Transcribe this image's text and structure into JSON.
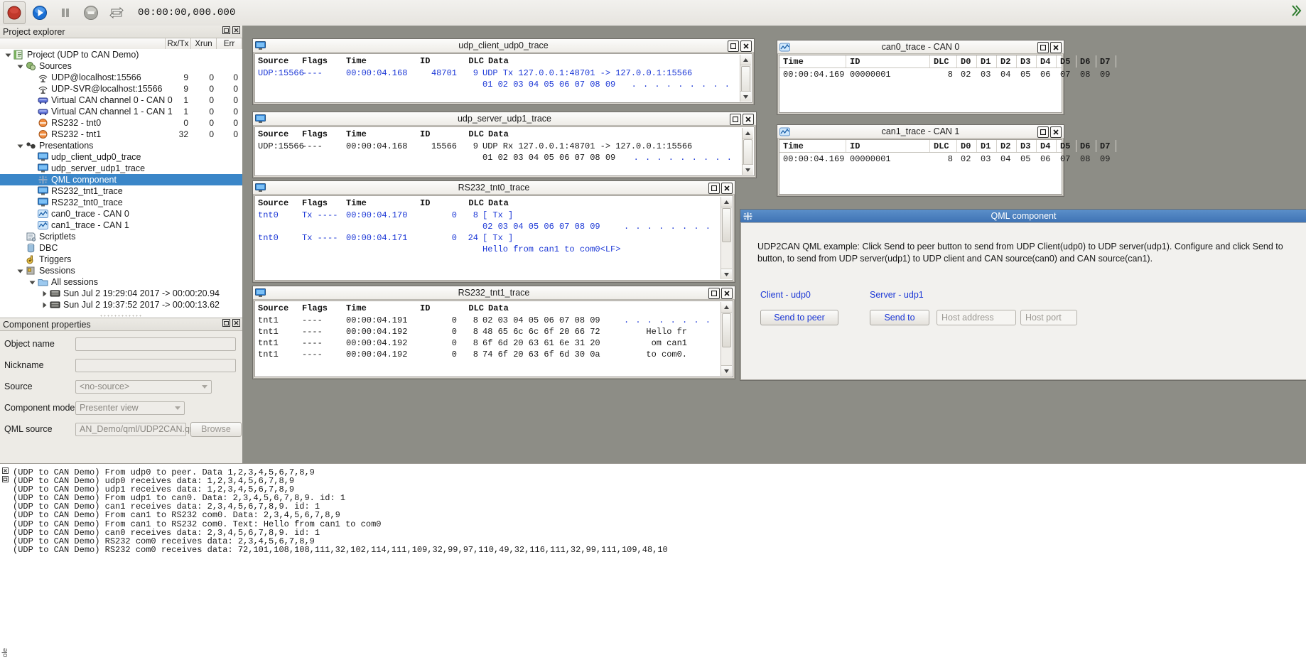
{
  "toolbar": {
    "time": "00:00:00,000.000",
    "buttons": [
      {
        "name": "record-button",
        "icon": "record-icon"
      },
      {
        "name": "play-button",
        "icon": "play-icon"
      },
      {
        "name": "pause-button",
        "icon": "pause-icon"
      },
      {
        "name": "stop-button",
        "icon": "stop-icon"
      },
      {
        "name": "loop-button",
        "icon": "loop-icon"
      }
    ]
  },
  "explorer": {
    "title": "Project explorer",
    "columns": [
      "",
      "Rx/Tx",
      "Xrun",
      "Err"
    ],
    "rows": [
      {
        "indent": 0,
        "twisty": "down",
        "icon": "project-icon",
        "label": "Project (UDP to CAN Demo)",
        "n1": "",
        "n2": "",
        "n3": "",
        "selected": false
      },
      {
        "indent": 1,
        "twisty": "down",
        "icon": "sources-icon",
        "label": "Sources",
        "n1": "",
        "n2": "",
        "n3": "",
        "selected": false
      },
      {
        "indent": 2,
        "twisty": "none",
        "icon": "udp-icon",
        "label": "UDP@localhost:15566",
        "n1": "9",
        "n2": "0",
        "n3": "0",
        "selected": false
      },
      {
        "indent": 2,
        "twisty": "none",
        "icon": "udp-icon",
        "label": "UDP-SVR@localhost:15566",
        "n1": "9",
        "n2": "0",
        "n3": "0",
        "selected": false
      },
      {
        "indent": 2,
        "twisty": "none",
        "icon": "can-icon",
        "label": "Virtual CAN channel 0 - CAN 0",
        "n1": "1",
        "n2": "0",
        "n3": "0",
        "selected": false
      },
      {
        "indent": 2,
        "twisty": "none",
        "icon": "can-icon",
        "label": "Virtual CAN channel 1 - CAN 1",
        "n1": "1",
        "n2": "0",
        "n3": "0",
        "selected": false
      },
      {
        "indent": 2,
        "twisty": "none",
        "icon": "serial-icon",
        "label": "RS232 - tnt0",
        "n1": "0",
        "n2": "0",
        "n3": "0",
        "selected": false
      },
      {
        "indent": 2,
        "twisty": "none",
        "icon": "serial-icon",
        "label": "RS232 - tnt1",
        "n1": "32",
        "n2": "0",
        "n3": "0",
        "selected": false
      },
      {
        "indent": 1,
        "twisty": "down",
        "icon": "presentations-icon",
        "label": "Presentations",
        "n1": "",
        "n2": "",
        "n3": "",
        "selected": false
      },
      {
        "indent": 2,
        "twisty": "none",
        "icon": "monitor-icon",
        "label": "udp_client_udp0_trace",
        "n1": "",
        "n2": "",
        "n3": "",
        "selected": false
      },
      {
        "indent": 2,
        "twisty": "none",
        "icon": "monitor-icon",
        "label": "udp_server_udp1_trace",
        "n1": "",
        "n2": "",
        "n3": "",
        "selected": false
      },
      {
        "indent": 2,
        "twisty": "none",
        "icon": "qml-icon",
        "label": "QML component",
        "n1": "",
        "n2": "",
        "n3": "",
        "selected": true
      },
      {
        "indent": 2,
        "twisty": "none",
        "icon": "monitor-icon",
        "label": "RS232_tnt1_trace",
        "n1": "",
        "n2": "",
        "n3": "",
        "selected": false
      },
      {
        "indent": 2,
        "twisty": "none",
        "icon": "monitor-icon",
        "label": "RS232_tnt0_trace",
        "n1": "",
        "n2": "",
        "n3": "",
        "selected": false
      },
      {
        "indent": 2,
        "twisty": "none",
        "icon": "cantrace-icon",
        "label": "can0_trace - CAN 0",
        "n1": "",
        "n2": "",
        "n3": "",
        "selected": false
      },
      {
        "indent": 2,
        "twisty": "none",
        "icon": "cantrace-icon",
        "label": "can1_trace - CAN 1",
        "n1": "",
        "n2": "",
        "n3": "",
        "selected": false
      },
      {
        "indent": 1,
        "twisty": "none",
        "icon": "scriptlets-icon",
        "label": "Scriptlets",
        "n1": "",
        "n2": "",
        "n3": "",
        "selected": false
      },
      {
        "indent": 1,
        "twisty": "none",
        "icon": "dbc-icon",
        "label": "DBC",
        "n1": "",
        "n2": "",
        "n3": "",
        "selected": false
      },
      {
        "indent": 1,
        "twisty": "none",
        "icon": "triggers-icon",
        "label": "Triggers",
        "n1": "",
        "n2": "",
        "n3": "",
        "selected": false
      },
      {
        "indent": 1,
        "twisty": "down",
        "icon": "sessions-icon",
        "label": "Sessions",
        "n1": "",
        "n2": "",
        "n3": "",
        "selected": false
      },
      {
        "indent": 2,
        "twisty": "down",
        "icon": "folder-icon",
        "label": "All sessions",
        "n1": "",
        "n2": "",
        "n3": "",
        "selected": false
      },
      {
        "indent": 3,
        "twisty": "right",
        "icon": "session-icon",
        "label": "Sun Jul 2 19:29:04 2017 -> 00:00:20.94",
        "n1": "",
        "n2": "",
        "n3": "",
        "selected": false
      },
      {
        "indent": 3,
        "twisty": "right",
        "icon": "session-icon",
        "label": "Sun Jul 2 19:37:52 2017 -> 00:00:13.62",
        "n1": "",
        "n2": "",
        "n3": "",
        "selected": false
      }
    ]
  },
  "properties": {
    "title": "Component properties",
    "fields": [
      {
        "label": "Object name",
        "value": "",
        "kind": "text"
      },
      {
        "label": "Nickname",
        "value": "",
        "kind": "text"
      },
      {
        "label": "Source",
        "value": "<no-source>",
        "kind": "combo"
      },
      {
        "label": "Component mode",
        "value": "Presenter view",
        "kind": "combo-small"
      },
      {
        "label": "QML source",
        "value": "AN_Demo/qml/UDP2CAN.qml",
        "kind": "text-browse",
        "button": "Browse"
      }
    ]
  },
  "windows": {
    "udp_client": {
      "title": "udp_client_udp0_trace",
      "icon": "monitor-icon",
      "columns": [
        "Source",
        "Flags",
        "Time",
        "ID",
        "DLC",
        "Data"
      ],
      "rows": [
        {
          "source": "UDP:15566",
          "flags": "----",
          "time": "00:00:04.168",
          "id": "48701",
          "dlc": "9",
          "data": "UDP Tx 127.0.0.1:48701 -> 127.0.0.1:15566",
          "color": "blue"
        },
        {
          "source": "",
          "flags": "",
          "time": "",
          "id": "",
          "dlc": "",
          "data": "01 02 03 04 05 06 07 08 09",
          "ascii": ". . . . . . . . .",
          "color": "blue"
        }
      ]
    },
    "udp_server": {
      "title": "udp_server_udp1_trace",
      "icon": "monitor-icon",
      "columns": [
        "Source",
        "Flags",
        "Time",
        "ID",
        "DLC",
        "Data"
      ],
      "rows": [
        {
          "source": "UDP:15566",
          "flags": "----",
          "time": "00:00:04.168",
          "id": "15566",
          "dlc": "9",
          "data": "UDP Rx 127.0.0.1:48701 -> 127.0.0.1:15566",
          "color": "black"
        },
        {
          "source": "",
          "flags": "",
          "time": "",
          "id": "",
          "dlc": "",
          "data": "01 02 03 04 05 06 07 08 09",
          "ascii": ". . . . . . . . .",
          "color": "black"
        }
      ]
    },
    "rs232_tnt0": {
      "title": "RS232_tnt0_trace",
      "icon": "monitor-icon",
      "columns": [
        "Source",
        "Flags",
        "Time",
        "ID",
        "DLC",
        "Data"
      ],
      "rows": [
        {
          "source": "tnt0",
          "flags": "Tx ----",
          "time": "00:00:04.170",
          "id": "0",
          "dlc": "8",
          "data": "[ Tx ]",
          "color": "blue"
        },
        {
          "source": "",
          "flags": "",
          "time": "",
          "id": "",
          "dlc": "",
          "data": "02 03 04 05 06 07 08 09",
          "ascii": ". . . . . . . .",
          "color": "blue"
        },
        {
          "source": "tnt0",
          "flags": "Tx ----",
          "time": "00:00:04.171",
          "id": "0",
          "dlc": "24",
          "data": "[ Tx ]",
          "color": "blue"
        },
        {
          "source": "",
          "flags": "",
          "time": "",
          "id": "",
          "dlc": "",
          "data": "Hello from can1 to com0<LF>",
          "color": "blue"
        }
      ]
    },
    "rs232_tnt1": {
      "title": "RS232_tnt1_trace",
      "icon": "monitor-icon",
      "columns": [
        "Source",
        "Flags",
        "Time",
        "ID",
        "DLC",
        "Data"
      ],
      "rows": [
        {
          "source": "tnt1",
          "flags": "----",
          "time": "00:00:04.191",
          "id": "0",
          "dlc": "8",
          "data": "02 03 04 05 06 07 08 09",
          "ascii": ". . . . . . . .",
          "color": "black"
        },
        {
          "source": "tnt1",
          "flags": "----",
          "time": "00:00:04.192",
          "id": "0",
          "dlc": "8",
          "data": "48 65 6c 6c 6f 20 66 72",
          "ascii": "Hello fr",
          "color": "black"
        },
        {
          "source": "tnt1",
          "flags": "----",
          "time": "00:00:04.192",
          "id": "0",
          "dlc": "8",
          "data": "6f 6d 20 63 61 6e 31 20",
          "ascii": "om can1",
          "color": "black"
        },
        {
          "source": "tnt1",
          "flags": "----",
          "time": "00:00:04.192",
          "id": "0",
          "dlc": "8",
          "data": "74 6f 20 63 6f 6d 30 0a",
          "ascii": "to com0.",
          "color": "black"
        }
      ]
    },
    "can0": {
      "title": "can0_trace - CAN 0",
      "icon": "cantrace-icon",
      "columns": [
        "Time",
        "ID",
        "DLC",
        "D0",
        "D1",
        "D2",
        "D3",
        "D4",
        "D5",
        "D6",
        "D7"
      ],
      "rows": [
        {
          "time": "00:00:04.169",
          "id": "00000001",
          "dlc": "8",
          "bytes": [
            "02",
            "03",
            "04",
            "05",
            "06",
            "07",
            "08",
            "09"
          ]
        }
      ]
    },
    "can1": {
      "title": "can1_trace - CAN 1",
      "icon": "cantrace-icon",
      "columns": [
        "Time",
        "ID",
        "DLC",
        "D0",
        "D1",
        "D2",
        "D3",
        "D4",
        "D5",
        "D6",
        "D7"
      ],
      "rows": [
        {
          "time": "00:00:04.169",
          "id": "00000001",
          "dlc": "8",
          "bytes": [
            "02",
            "03",
            "04",
            "05",
            "06",
            "07",
            "08",
            "09"
          ]
        }
      ]
    },
    "qml": {
      "title": "QML component",
      "icon": "qml-icon",
      "description": "UDP2CAN QML example: Click Send to peer button to send from UDP Client(udp0) to UDP server(udp1).  Configure and click Send to button, to send from UDP server(udp1) to UDP client and CAN source(can0)  and CAN source(can1).",
      "client_label": "Client - udp0",
      "server_label": "Server - udp1",
      "send_to_peer_button": "Send to peer",
      "send_to_button": "Send to",
      "host_address_placeholder": "Host address",
      "host_port_placeholder": "Host port"
    }
  },
  "log": {
    "lines": [
      "(UDP to CAN Demo) From udp0 to peer. Data 1,2,3,4,5,6,7,8,9",
      "(UDP to CAN Demo) udp0 receives data: 1,2,3,4,5,6,7,8,9",
      "(UDP to CAN Demo) udp1 receives data: 1,2,3,4,5,6,7,8,9",
      "(UDP to CAN Demo) From udp1 to can0. Data: 2,3,4,5,6,7,8,9. id: 1",
      "(UDP to CAN Demo) can1 receives data: 2,3,4,5,6,7,8,9. id: 1",
      "(UDP to CAN Demo) From can1 to RS232 com0. Data: 2,3,4,5,6,7,8,9",
      "(UDP to CAN Demo) From can1 to RS232 com0. Text: Hello from can1 to com0",
      "(UDP to CAN Demo) can0 receives data: 2,3,4,5,6,7,8,9. id: 1",
      "(UDP to CAN Demo) RS232 com0 receives data: 2,3,4,5,6,7,8,9",
      "(UDP to CAN Demo) RS232 com0 receives data: 72,101,108,108,111,32,102,114,111,109,32,99,97,110,49,32,116,111,32,99,111,109,48,10"
    ]
  },
  "colors": {
    "selection": "#3a86c8",
    "trace_blue": "#1b37d6",
    "desktop": "#8d8d86",
    "title_active": "#3f73b4"
  }
}
